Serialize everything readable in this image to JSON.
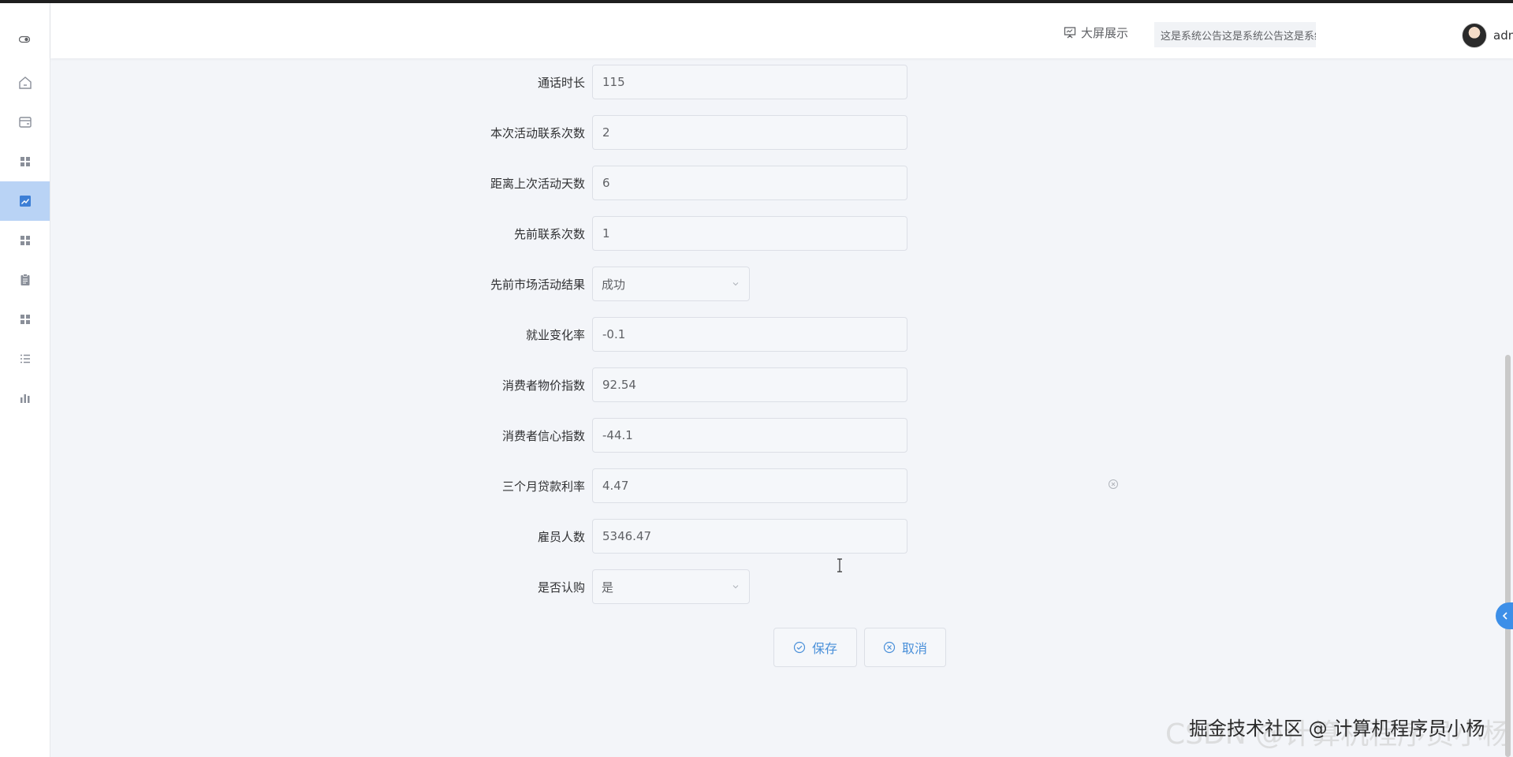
{
  "header": {
    "bigscreen_label": "大屏展示",
    "notice_text": "这是系统公告这是系统公告这是系统公告这",
    "username": "admin"
  },
  "sidebar": {
    "items": [
      {
        "icon": "home-icon"
      },
      {
        "icon": "wallet-icon"
      },
      {
        "icon": "grid-icon"
      },
      {
        "icon": "chart-line-icon",
        "active": true
      },
      {
        "icon": "grid-icon"
      },
      {
        "icon": "clipboard-icon"
      },
      {
        "icon": "grid-icon"
      },
      {
        "icon": "list-icon"
      },
      {
        "icon": "bar-chart-icon"
      }
    ]
  },
  "form": {
    "fields": [
      {
        "label": "通话时长",
        "value": "115",
        "type": "input"
      },
      {
        "label": "本次活动联系次数",
        "value": "2",
        "type": "input"
      },
      {
        "label": "距离上次活动天数",
        "value": "6",
        "type": "input"
      },
      {
        "label": "先前联系次数",
        "value": "1",
        "type": "input"
      },
      {
        "label": "先前市场活动结果",
        "value": "成功",
        "type": "select"
      },
      {
        "label": "就业变化率",
        "value": "-0.1",
        "type": "input"
      },
      {
        "label": "消费者物价指数",
        "value": "92.54",
        "type": "input"
      },
      {
        "label": "消费者信心指数",
        "value": "-44.1",
        "type": "input"
      },
      {
        "label": "三个月贷款利率",
        "value": "4.47",
        "type": "input"
      },
      {
        "label": "雇员人数",
        "value": "5346.47",
        "type": "input"
      },
      {
        "label": "是否认购",
        "value": "是",
        "type": "select"
      }
    ],
    "save_label": "保存",
    "cancel_label": "取消"
  },
  "watermark": {
    "csdn": "CSDN @计算机程序员小杨",
    "juejin": "掘金技术社区 @ 计算机程序员小杨"
  },
  "colors": {
    "accent": "#4a90d9",
    "active_nav": "#b9d3f5",
    "field_bg": "#f5f7fa"
  }
}
